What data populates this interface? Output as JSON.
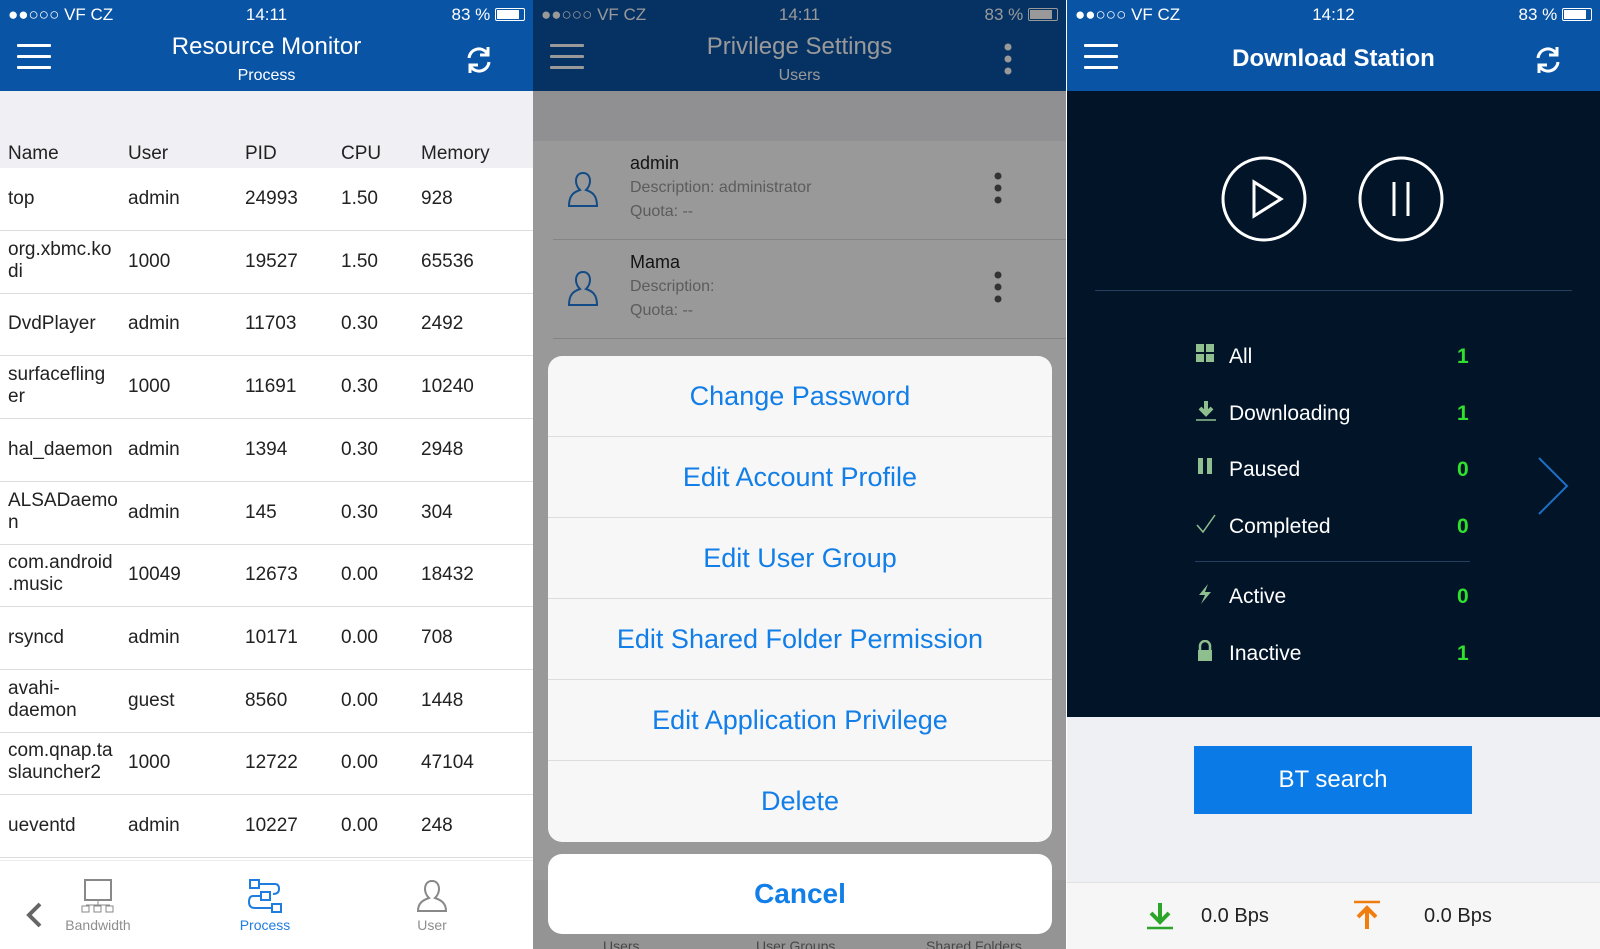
{
  "status_bars": [
    {
      "carrier": "●●○○○ VF CZ",
      "time": "14:11",
      "battery": "83 %"
    },
    {
      "carrier": "●●○○○ VF CZ",
      "time": "14:11",
      "battery": "83 %"
    },
    {
      "carrier": "●●○○○ VF CZ",
      "time": "14:12",
      "battery": "83 %"
    }
  ],
  "resource_monitor": {
    "title": "Resource Monitor",
    "subtitle": "Process",
    "columns": [
      "Name",
      "User",
      "PID",
      "CPU",
      "Memory"
    ],
    "rows": [
      [
        "top",
        "admin",
        "24993",
        "1.50",
        "928"
      ],
      [
        "org.xbmc.ko di",
        "1000",
        "19527",
        "1.50",
        "65536"
      ],
      [
        "DvdPlayer",
        "admin",
        "11703",
        "0.30",
        "2492"
      ],
      [
        "surfacefling er",
        "1000",
        "11691",
        "0.30",
        "10240"
      ],
      [
        "hal_daemon",
        "admin",
        "1394",
        "0.30",
        "2948"
      ],
      [
        "ALSADaemo n",
        "admin",
        "145",
        "0.30",
        "304"
      ],
      [
        "com.android .music",
        "10049",
        "12673",
        "0.00",
        "18432"
      ],
      [
        "rsyncd",
        "admin",
        "10171",
        "0.00",
        "708"
      ],
      [
        "avahi- daemon",
        "guest",
        "8560",
        "0.00",
        "1448"
      ],
      [
        "com.qnap.ta slauncher2",
        "1000",
        "12722",
        "0.00",
        "47104"
      ],
      [
        "ueventd",
        "admin",
        "10227",
        "0.00",
        "248"
      ]
    ],
    "tabs": [
      {
        "label": "Bandwidth",
        "active": false
      },
      {
        "label": "Process",
        "active": true
      },
      {
        "label": "User",
        "active": false
      }
    ],
    "accent": "#1f7de0"
  },
  "privilege_settings": {
    "title": "Privilege Settings",
    "subtitle": "Users",
    "users": [
      {
        "name": "admin",
        "description": "Description: administrator",
        "quota": "Quota: --"
      },
      {
        "name": "Mama",
        "description": "Description:",
        "quota": "Quota: --"
      }
    ],
    "actions": [
      "Change Password",
      "Edit Account Profile",
      "Edit User Group",
      "Edit Shared Folder Permission",
      "Edit Application Privilege",
      "Delete"
    ],
    "cancel": "Cancel",
    "tabs": [
      "Users",
      "User Groups",
      "Shared Folders"
    ]
  },
  "download_station": {
    "title": "Download Station",
    "stats": [
      {
        "icon": "grid-icon",
        "label": "All",
        "count": "1"
      },
      {
        "icon": "download-icon",
        "label": "Downloading",
        "count": "1"
      },
      {
        "icon": "pause-icon",
        "label": "Paused",
        "count": "0"
      },
      {
        "icon": "check-icon",
        "label": "Completed",
        "count": "0"
      },
      {
        "icon": "bolt-icon",
        "label": "Active",
        "count": "0"
      },
      {
        "icon": "lock-icon",
        "label": "Inactive",
        "count": "1"
      }
    ],
    "bt_search": "BT search",
    "download_speed": "0.0 Bps",
    "upload_speed": "0.0 Bps"
  }
}
